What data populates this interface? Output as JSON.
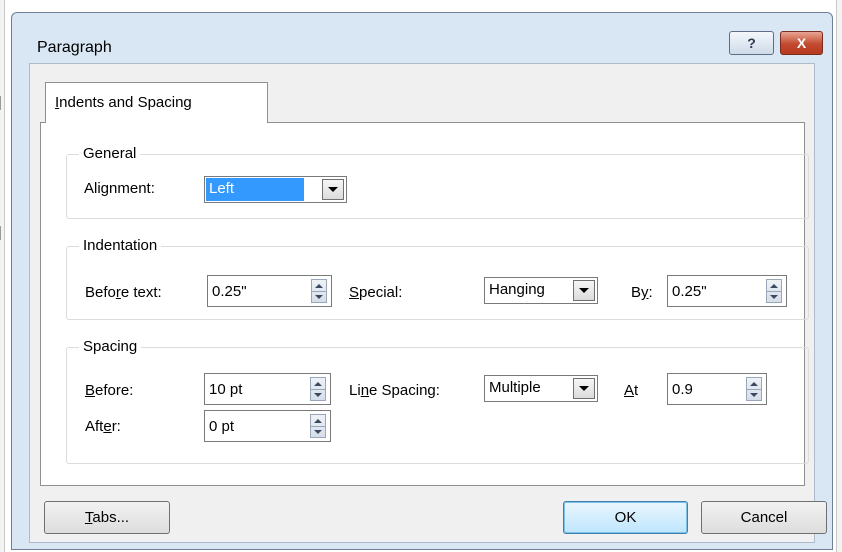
{
  "dialog": {
    "title": "Paragraph",
    "help_glyph": "?",
    "close_glyph": "X"
  },
  "tab": {
    "label_first": "I",
    "label_rest": "ndents and Spacing"
  },
  "general": {
    "title": "General",
    "alignment_label": {
      "pre": "Ali",
      "key": "g",
      "post": "nment:"
    },
    "alignment_value": "Left"
  },
  "indentation": {
    "title": "Indentation",
    "before_text_label": {
      "pre": "Befo",
      "key": "r",
      "post": "e text:"
    },
    "before_text_value": "0.25\"",
    "special_label": {
      "pre": "",
      "key": "S",
      "post": "pecial:"
    },
    "special_value": "Hanging",
    "by_label": {
      "pre": "B",
      "key": "y",
      "post": ":"
    },
    "by_value": "0.25\""
  },
  "spacing": {
    "title": "Spacing",
    "before_label": {
      "pre": "",
      "key": "B",
      "post": "efore:"
    },
    "before_value": "10 pt",
    "after_label": {
      "pre": "Aft",
      "key": "e",
      "post": "r:"
    },
    "after_value": "0 pt",
    "line_spacing_label": {
      "pre": "Li",
      "key": "n",
      "post": "e Spacing:"
    },
    "line_spacing_value": "Multiple",
    "at_label": {
      "pre": "",
      "key": "A",
      "post": "t"
    },
    "at_value": "0.9"
  },
  "buttons": {
    "tabs": {
      "pre": "",
      "key": "T",
      "post": "abs..."
    },
    "ok": "OK",
    "cancel": "Cancel"
  },
  "colors": {
    "titlebar": "#d9e6f3",
    "selection": "#3399ff",
    "close_button": "#c24a2f"
  }
}
